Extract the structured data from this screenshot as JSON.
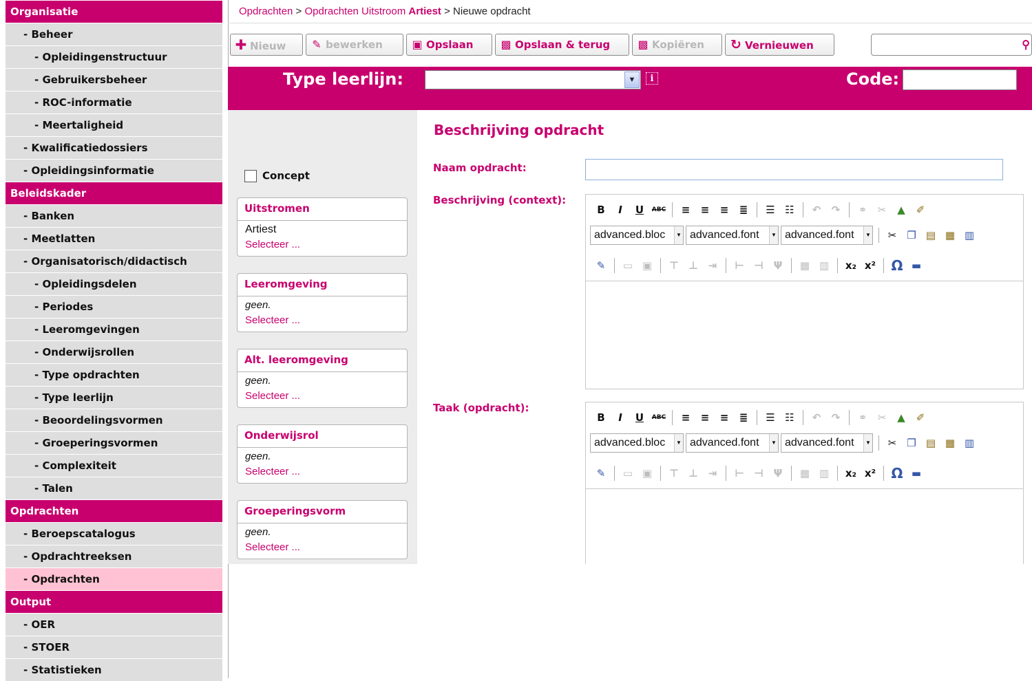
{
  "sidebar": {
    "items": [
      {
        "label": "Organisatie",
        "type": "header"
      },
      {
        "label": "- Beheer",
        "type": "lvl1"
      },
      {
        "label": "- Opleidingenstructuur",
        "type": "lvl2"
      },
      {
        "label": "- Gebruikersbeheer",
        "type": "lvl2"
      },
      {
        "label": "- ROC-informatie",
        "type": "lvl2"
      },
      {
        "label": "- Meertaligheid",
        "type": "lvl2"
      },
      {
        "label": "- Kwalificatiedossiers",
        "type": "lvl1"
      },
      {
        "label": "- Opleidingsinformatie",
        "type": "lvl1"
      },
      {
        "label": "Beleidskader",
        "type": "header"
      },
      {
        "label": "- Banken",
        "type": "lvl1"
      },
      {
        "label": "- Meetlatten",
        "type": "lvl1"
      },
      {
        "label": "- Organisatorisch/didactisch",
        "type": "lvl1"
      },
      {
        "label": "- Opleidingsdelen",
        "type": "lvl2"
      },
      {
        "label": "- Periodes",
        "type": "lvl2"
      },
      {
        "label": "- Leeromgevingen",
        "type": "lvl2"
      },
      {
        "label": "- Onderwijsrollen",
        "type": "lvl2"
      },
      {
        "label": "- Type opdrachten",
        "type": "lvl2"
      },
      {
        "label": "- Type leerlijn",
        "type": "lvl2"
      },
      {
        "label": "- Beoordelingsvormen",
        "type": "lvl2"
      },
      {
        "label": "- Groeperingsvormen",
        "type": "lvl2"
      },
      {
        "label": "- Complexiteit",
        "type": "lvl2"
      },
      {
        "label": "- Talen",
        "type": "lvl2"
      },
      {
        "label": "Opdrachten",
        "type": "header"
      },
      {
        "label": "- Beroepscatalogus",
        "type": "lvl1"
      },
      {
        "label": "- Opdrachtreeksen",
        "type": "lvl1"
      },
      {
        "label": "- Opdrachten",
        "type": "lvl1",
        "active": true
      },
      {
        "label": "Output",
        "type": "header"
      },
      {
        "label": "- OER",
        "type": "lvl1"
      },
      {
        "label": "- STOER",
        "type": "lvl1"
      },
      {
        "label": "- Statistieken",
        "type": "lvl1"
      }
    ]
  },
  "breadcrumb": {
    "part1": "Opdrachten",
    "sep1": " > ",
    "part2_prefix": "Opdrachten Uitstroom ",
    "part2_bold": "Artiest",
    "sep2": " > ",
    "current": "Nieuwe opdracht"
  },
  "toolbar": {
    "new_label": "Nieuw",
    "edit_label": "bewerken",
    "save_label": "Opslaan",
    "save_back_label": "Opslaan & terug",
    "copy_label": "Kopiëren",
    "refresh_label": "Vernieuwen",
    "search_value": ""
  },
  "band": {
    "type_label": "Type leerlijn:",
    "type_value": "",
    "info_glyph": "i",
    "code_label": "Code:",
    "code_value": ""
  },
  "left": {
    "concept_label": "Concept",
    "concept_checked": false,
    "cards": [
      {
        "title": "Uitstromen",
        "value": "Artiest",
        "italic": false,
        "link": "Selecteer ..."
      },
      {
        "title": "Leeromgeving",
        "value": "geen.",
        "italic": true,
        "link": "Selecteer ..."
      },
      {
        "title": "Alt. leeromgeving",
        "value": "geen.",
        "italic": true,
        "link": "Selecteer ..."
      },
      {
        "title": "Onderwijsrol",
        "value": "geen.",
        "italic": true,
        "link": "Selecteer ..."
      },
      {
        "title": "Groeperingsvorm",
        "value": "geen.",
        "italic": true,
        "link": "Selecteer ..."
      }
    ]
  },
  "main": {
    "title": "Beschrijving opdracht",
    "naam_label": "Naam opdracht:",
    "naam_value": "",
    "beschrijving_label": "Beschrijving (context):",
    "taak_label": "Taak (opdracht):",
    "editor_dropdowns": [
      "advanced.bloc",
      "advanced.font",
      "advanced.font"
    ]
  },
  "colors": {
    "accent": "#c8006e",
    "nav_bg": "#dedede",
    "nav_active": "#ffc2d4"
  }
}
